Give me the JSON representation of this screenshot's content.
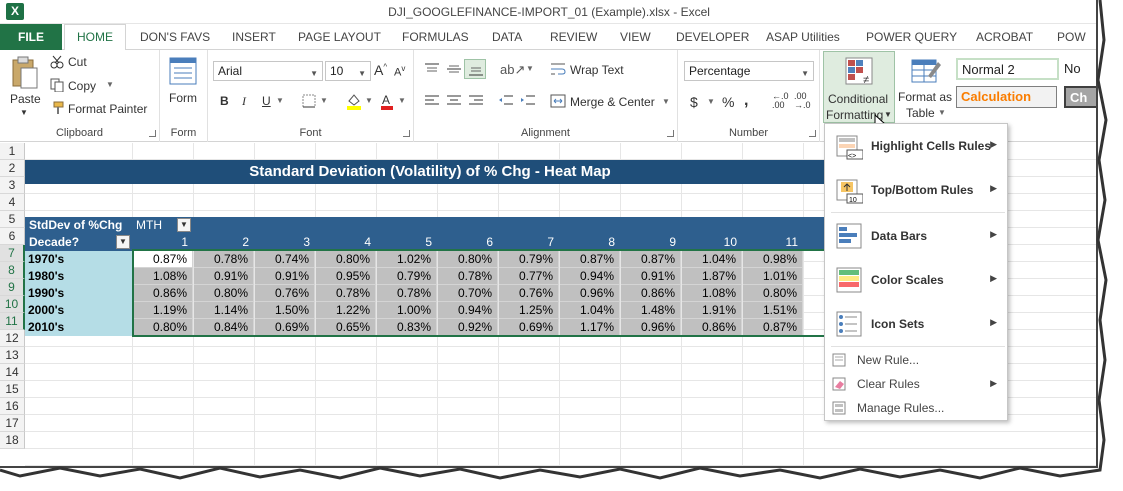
{
  "window": {
    "title": "DJI_GOOGLEFINANCE-IMPORT_01 (Example).xlsx - Excel",
    "logo": "X"
  },
  "tabs": [
    "FILE",
    "HOME",
    "DON'S FAVS",
    "INSERT",
    "PAGE LAYOUT",
    "FORMULAS",
    "DATA",
    "REVIEW",
    "VIEW",
    "DEVELOPER",
    "ASAP Utilities",
    "POWER QUERY",
    "ACROBAT",
    "POW"
  ],
  "ribbon": {
    "clipboard": {
      "paste": "Paste",
      "cut": "Cut",
      "copy": "Copy",
      "format_painter": "Format Painter",
      "label": "Clipboard"
    },
    "form": {
      "btn": "Form",
      "label": "Form"
    },
    "font": {
      "name": "Arial",
      "size": "10",
      "bold": "B",
      "italic": "I",
      "underline": "U",
      "label": "Font"
    },
    "alignment": {
      "wrap": "Wrap Text",
      "merge": "Merge & Center",
      "label": "Alignment"
    },
    "number": {
      "format": "Percentage",
      "currency": "$",
      "percent": "%",
      "comma": ",",
      "inc": "←.0\n.00",
      "dec": ".00\n→.0",
      "label": "Number"
    },
    "styles": {
      "cond_fmt_1": "Conditional",
      "cond_fmt_2": "Formatting",
      "fmt_table_1": "Format as",
      "fmt_table_2": "Table",
      "normal2": "Normal 2",
      "calculation": "Calculation",
      "no_cut": "No",
      "ch_cut": "Ch"
    }
  },
  "sheet": {
    "rows": [
      "1",
      "2",
      "3",
      "4",
      "5",
      "6",
      "7",
      "8",
      "9",
      "10",
      "11",
      "12",
      "13",
      "14",
      "15",
      "16",
      "17",
      "18"
    ],
    "title": "Standard Deviation (Volatility) of % Chg - Heat Map",
    "hdr_stddev": "StdDev of %Chg",
    "hdr_mth": "MTH",
    "hdr_decade": "Decade?",
    "months": [
      "1",
      "2",
      "3",
      "4",
      "5",
      "6",
      "7",
      "8",
      "9",
      "10",
      "11"
    ],
    "decades": [
      "1970's",
      "1980's",
      "1990's",
      "2000's",
      "2010's"
    ],
    "values": [
      [
        "0.87%",
        "0.78%",
        "0.74%",
        "0.80%",
        "1.02%",
        "0.80%",
        "0.79%",
        "0.87%",
        "0.87%",
        "1.04%",
        "0.98%"
      ],
      [
        "1.08%",
        "0.91%",
        "0.91%",
        "0.95%",
        "0.79%",
        "0.78%",
        "0.77%",
        "0.94%",
        "0.91%",
        "1.87%",
        "1.01%"
      ],
      [
        "0.86%",
        "0.80%",
        "0.76%",
        "0.78%",
        "0.78%",
        "0.70%",
        "0.76%",
        "0.96%",
        "0.86%",
        "1.08%",
        "0.80%"
      ],
      [
        "1.19%",
        "1.14%",
        "1.50%",
        "1.22%",
        "1.00%",
        "0.94%",
        "1.25%",
        "1.04%",
        "1.48%",
        "1.91%",
        "1.51%"
      ],
      [
        "0.80%",
        "0.84%",
        "0.69%",
        "0.65%",
        "0.83%",
        "0.92%",
        "0.69%",
        "1.17%",
        "0.96%",
        "0.86%",
        "0.87%"
      ]
    ]
  },
  "menu": {
    "items": [
      "Highlight Cells Rules",
      "Top/Bottom Rules",
      "Data Bars",
      "Color Scales",
      "Icon Sets"
    ],
    "simple": [
      "New Rule...",
      "Clear Rules",
      "Manage Rules..."
    ]
  },
  "colors": {
    "excel_green": "#217346",
    "banner": "#1f4e79",
    "header_band": "#2e5f8e",
    "label_col": "#b5dde6",
    "cell_gray": "#c0c0c0"
  }
}
